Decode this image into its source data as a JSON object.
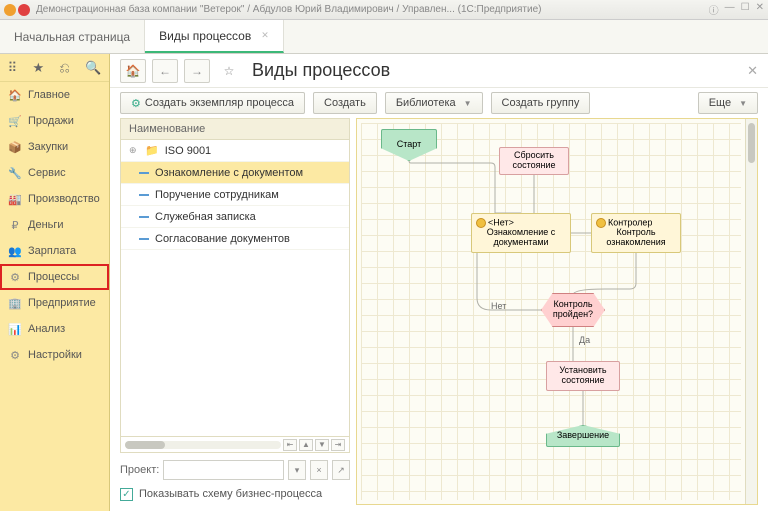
{
  "titlebar": {
    "text": "Демонстрационная база компании \"Ветерок\" / Абдулов Юрий Владимирович / Управлен... (1С:Предприятие)"
  },
  "tabs": {
    "start": "Начальная страница",
    "active": "Виды процессов"
  },
  "sidebar": {
    "items": [
      {
        "icon": "🏠",
        "label": "Главное"
      },
      {
        "icon": "🛒",
        "label": "Продажи"
      },
      {
        "icon": "📦",
        "label": "Закупки"
      },
      {
        "icon": "🔧",
        "label": "Сервис"
      },
      {
        "icon": "🏭",
        "label": "Производство"
      },
      {
        "icon": "₽",
        "label": "Деньги"
      },
      {
        "icon": "👥",
        "label": "Зарплата"
      },
      {
        "icon": "⚙",
        "label": "Процессы"
      },
      {
        "icon": "🏢",
        "label": "Предприятие"
      },
      {
        "icon": "📊",
        "label": "Анализ"
      },
      {
        "icon": "⚙",
        "label": "Настройки"
      }
    ]
  },
  "header": {
    "title": "Виды процессов"
  },
  "toolbar": {
    "create_instance": "Создать экземпляр процесса",
    "create": "Создать",
    "library": "Библиотека",
    "create_group": "Создать группу",
    "more": "Еще"
  },
  "tree": {
    "header": "Наименование",
    "folder": "ISO 9001",
    "rows": [
      "Ознакомление с документом",
      "Поручение сотрудникам",
      "Служебная записка",
      "Согласование документов"
    ]
  },
  "project": {
    "label": "Проект:"
  },
  "checkbox": {
    "label": "Показывать схему бизнес-процесса"
  },
  "diagram": {
    "start": "Старт",
    "reset": "Сбросить состояние",
    "empty_head": "<Нет>",
    "empty_body": "Ознакомление с документами",
    "ctrl_head": "Контролер",
    "ctrl_body": "Контроль ознакомления",
    "decision": "Контроль пройден?",
    "no": "Нет",
    "yes": "Да",
    "set": "Установить состояние",
    "end": "Завершение"
  }
}
